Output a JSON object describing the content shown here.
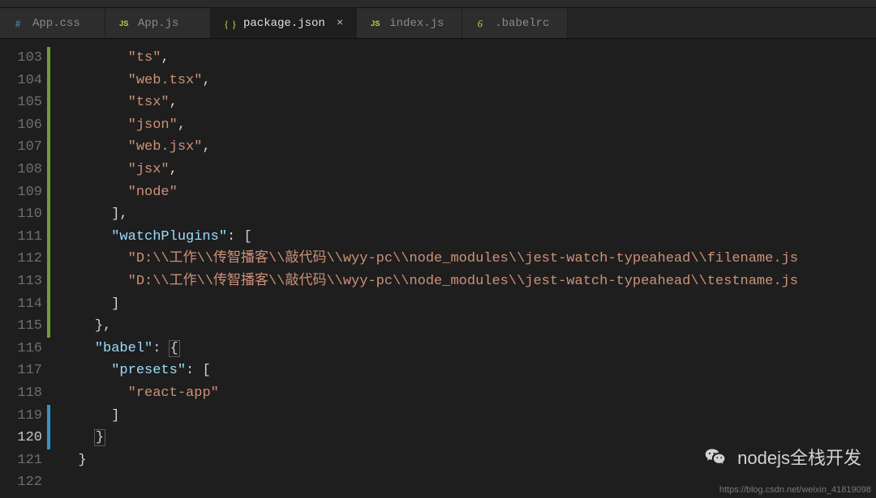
{
  "tabs": [
    {
      "icon": "hash-icon",
      "iconColor": "#519aba",
      "label": "App.css",
      "active": false,
      "dirty": false
    },
    {
      "icon": "js-icon",
      "iconColor": "#cbcb41",
      "label": "App.js",
      "active": false,
      "dirty": false
    },
    {
      "icon": "json-icon",
      "iconColor": "#cbcb41",
      "label": "package.json",
      "active": true,
      "dirty": true
    },
    {
      "icon": "js-icon",
      "iconColor": "#cbcb41",
      "label": "index.js",
      "active": false,
      "dirty": false
    },
    {
      "icon": "babel-icon",
      "iconColor": "#cbcb41",
      "label": ".babelrc",
      "active": false,
      "dirty": false
    }
  ],
  "closeGlyph": "×",
  "lineStart": 103,
  "lineEnd": 122,
  "activeLine": 120,
  "gutterBars": [
    {
      "fromLine": 103,
      "toLine": 115,
      "color": "#6e9e3b"
    },
    {
      "fromLine": 119,
      "toLine": 120,
      "color": "#3794c4"
    }
  ],
  "code": {
    "l103": {
      "indent": 8,
      "str": "\"ts\"",
      "tail": ","
    },
    "l104": {
      "indent": 8,
      "str": "\"web.tsx\"",
      "tail": ","
    },
    "l105": {
      "indent": 8,
      "str": "\"tsx\"",
      "tail": ","
    },
    "l106": {
      "indent": 8,
      "str": "\"json\"",
      "tail": ","
    },
    "l107": {
      "indent": 8,
      "str": "\"web.jsx\"",
      "tail": ","
    },
    "l108": {
      "indent": 8,
      "str": "\"jsx\"",
      "tail": ","
    },
    "l109": {
      "indent": 8,
      "str": "\"node\"",
      "tail": ""
    },
    "l110": {
      "indent": 6,
      "pun": "],"
    },
    "l111": {
      "indent": 6,
      "key": "\"watchPlugins\"",
      "pun": ": ["
    },
    "l112": {
      "indent": 8,
      "str": "\"D:\\\\工作\\\\传智播客\\\\敲代码\\\\wyy-pc\\\\node_modules\\\\jest-watch-typeahead\\\\filename.js",
      "tail": ""
    },
    "l113": {
      "indent": 8,
      "str": "\"D:\\\\工作\\\\传智播客\\\\敲代码\\\\wyy-pc\\\\node_modules\\\\jest-watch-typeahead\\\\testname.js",
      "tail": ""
    },
    "l114": {
      "indent": 6,
      "pun": "]"
    },
    "l115": {
      "indent": 4,
      "pun": "},"
    },
    "l116": {
      "indent": 4,
      "key": "\"babel\"",
      "pun": ": ",
      "brkOpen": "{"
    },
    "l117": {
      "indent": 6,
      "key": "\"presets\"",
      "pun": ": ["
    },
    "l118": {
      "indent": 8,
      "str": "\"react-app\"",
      "tail": ""
    },
    "l119": {
      "indent": 6,
      "pun": "]"
    },
    "l120": {
      "indent": 4,
      "brkClose": "}"
    },
    "l121": {
      "indent": 2,
      "pun": "}"
    },
    "l122": {
      "indent": 0,
      "pun": ""
    }
  },
  "watermark": {
    "text": "nodejs全栈开发"
  },
  "footerUrl": "https://blog.csdn.net/weixin_41819098"
}
